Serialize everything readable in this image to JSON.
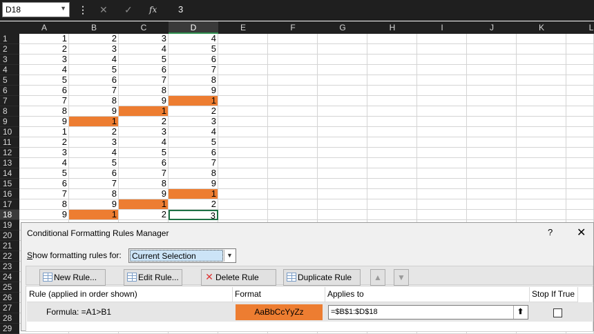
{
  "formula_bar": {
    "name_box": "D18",
    "fx_label": "fx",
    "formula_value": "3"
  },
  "columns": [
    "A",
    "B",
    "C",
    "D",
    "E",
    "F",
    "G",
    "H",
    "I",
    "J",
    "K",
    "L"
  ],
  "rows": [
    [
      "1",
      "2",
      "3",
      "4"
    ],
    [
      "2",
      "3",
      "4",
      "5"
    ],
    [
      "3",
      "4",
      "5",
      "6"
    ],
    [
      "4",
      "5",
      "6",
      "7"
    ],
    [
      "5",
      "6",
      "7",
      "8"
    ],
    [
      "6",
      "7",
      "8",
      "9"
    ],
    [
      "7",
      "8",
      "9",
      "1"
    ],
    [
      "8",
      "9",
      "1",
      "2"
    ],
    [
      "9",
      "1",
      "2",
      "3"
    ],
    [
      "1",
      "2",
      "3",
      "4"
    ],
    [
      "2",
      "3",
      "4",
      "5"
    ],
    [
      "3",
      "4",
      "5",
      "6"
    ],
    [
      "4",
      "5",
      "6",
      "7"
    ],
    [
      "5",
      "6",
      "7",
      "8"
    ],
    [
      "6",
      "7",
      "8",
      "9"
    ],
    [
      "7",
      "8",
      "9",
      "1"
    ],
    [
      "8",
      "9",
      "1",
      "2"
    ],
    [
      "9",
      "1",
      "2",
      "3"
    ]
  ],
  "highlighted_cells": [
    [
      7,
      "D"
    ],
    [
      8,
      "C"
    ],
    [
      9,
      "B"
    ],
    [
      16,
      "D"
    ],
    [
      17,
      "C"
    ],
    [
      18,
      "B"
    ]
  ],
  "row_numbers": [
    "1",
    "2",
    "3",
    "4",
    "5",
    "6",
    "7",
    "8",
    "9",
    "10",
    "11",
    "12",
    "13",
    "14",
    "15",
    "16",
    "17",
    "18",
    "19",
    "20",
    "21",
    "22",
    "23",
    "24",
    "25",
    "26",
    "27",
    "28",
    "29"
  ],
  "colors": {
    "highlight": "#ed7d31",
    "header_bg": "#202020",
    "selection_border": "#1e7145"
  },
  "dialog": {
    "title": "Conditional Formatting Rules Manager",
    "help": "?",
    "close": "✕",
    "show_rules_label": "Show formatting rules for:",
    "show_rules_value": "Current Selection",
    "buttons": {
      "new_rule": "New Rule...",
      "edit_rule": "Edit Rule...",
      "delete_rule": "Delete Rule",
      "duplicate_rule": "Duplicate Rule",
      "move_up": "▲",
      "move_down": "▼"
    },
    "table_headers": {
      "rule": "Rule (applied in order shown)",
      "format": "Format",
      "applies_to": "Applies to",
      "stop_if_true": "Stop If True"
    },
    "rule_row": {
      "rule": "Formula: =A1>B1",
      "format_preview": "AaBbCcYyZz",
      "applies_to": "=$B$1:$D$18",
      "ref_button": "⬆",
      "stop_if_true": false
    }
  }
}
